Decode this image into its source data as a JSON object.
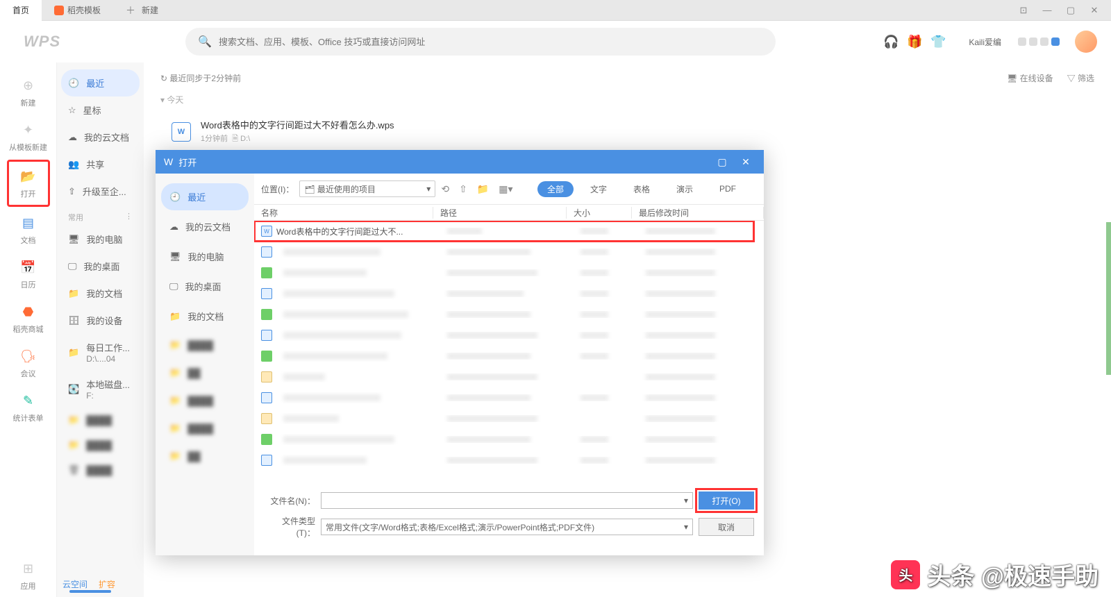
{
  "tabs": {
    "home": "首页",
    "template": "稻壳模板",
    "new": "新建"
  },
  "search": {
    "placeholder": "搜索文档、应用、模板、Office 技巧或直接访问网址"
  },
  "user": {
    "name": "Kaili爱编"
  },
  "rail": {
    "new": "新建",
    "from_template": "从模板新建",
    "open": "打开",
    "doc": "文档",
    "calendar": "日历",
    "store": "稻壳商城",
    "meeting": "会议",
    "form": "统计表单",
    "apps": "应用"
  },
  "sidebar": {
    "recent": "最近",
    "star": "星标",
    "cloud": "我的云文档",
    "share": "共享",
    "upgrade": "升级至企...",
    "section": "常用",
    "computer": "我的电脑",
    "desktop": "我的桌面",
    "docs": "我的文档",
    "devices": "我的设备",
    "daily": "每日工作...",
    "daily_sub": "D:\\....04",
    "local": "本地磁盘...",
    "local_sub": "F:",
    "footer1": "云空间",
    "footer2": "扩容"
  },
  "content": {
    "sync": "最近同步于2分钟前",
    "devices": "在线设备",
    "filter": "筛选",
    "today": "今天",
    "file_name": "Word表格中的文字行间距过大不好看怎么办.wps",
    "file_meta_time": "1分钟前",
    "file_meta_path": "D:\\"
  },
  "dialog": {
    "title": "打开",
    "side": {
      "recent": "最近",
      "cloud": "我的云文档",
      "computer": "我的电脑",
      "desktop": "我的桌面",
      "docs": "我的文档"
    },
    "toolbar": {
      "location_label": "位置(I)：",
      "location_value": "最近使用的项目"
    },
    "filters": {
      "all": "全部",
      "text": "文字",
      "sheet": "表格",
      "slide": "演示",
      "pdf": "PDF"
    },
    "columns": {
      "name": "名称",
      "path": "路径",
      "size": "大小",
      "date": "最后修改时间"
    },
    "first_row": "Word表格中的文字行间距过大不...",
    "footer": {
      "filename_label": "文件名(N)：",
      "filetype_label": "文件类型(T)：",
      "filetype_value": "常用文件(文字/Word格式;表格/Excel格式;演示/PowerPoint格式;PDF文件)",
      "open": "打开(O)",
      "cancel": "取消"
    }
  },
  "watermark": "头条 @极速手助"
}
